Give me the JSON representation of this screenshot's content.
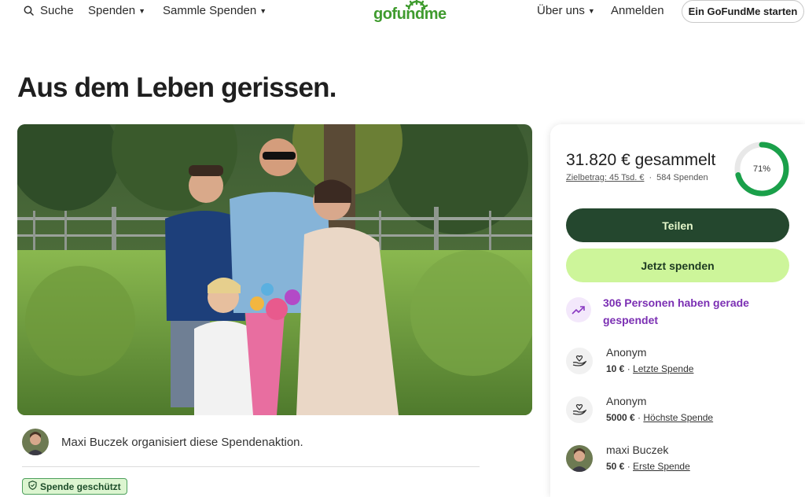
{
  "header": {
    "search_label": "Suche",
    "nav_spenden": "Spenden",
    "nav_sammle": "Sammle Spenden",
    "logo_text": "gofundme",
    "nav_about": "Über uns",
    "login": "Anmelden",
    "start_button": "Ein GoFundMe starten"
  },
  "campaign": {
    "title": "Aus dem Leben gerissen.",
    "organizer_text": "Maxi Buczek organisiert diese Spendenaktion.",
    "badge": "Spende geschützt"
  },
  "sidebar": {
    "amount_raised": "31.820 € gesammelt",
    "goal": "Zielbetrag: 45 Tsd. €",
    "donation_count": "584 Spenden",
    "progress_label": "71%",
    "progress_fraction": 0.71,
    "share_button": "Teilen",
    "donate_button": "Jetzt spenden",
    "trend_text": "306 Personen haben gerade gespendet",
    "donations": [
      {
        "name": "Anonym",
        "amount": "10 €",
        "label": "Letzte Spende",
        "icon": "heart-hand-icon"
      },
      {
        "name": "Anonym",
        "amount": "5000 €",
        "label": "Höchste Spende",
        "icon": "heart-hand-icon"
      },
      {
        "name": "maxi Buczek",
        "amount": "50 €",
        "label": "Erste Spende",
        "icon": "avatar"
      }
    ]
  },
  "colors": {
    "brand_green": "#3f9b2e",
    "share_button_bg": "#24472e",
    "donate_button_bg": "#cdf59a",
    "trend_purple": "#7b2fb3",
    "progress_green": "#1aa04a"
  }
}
